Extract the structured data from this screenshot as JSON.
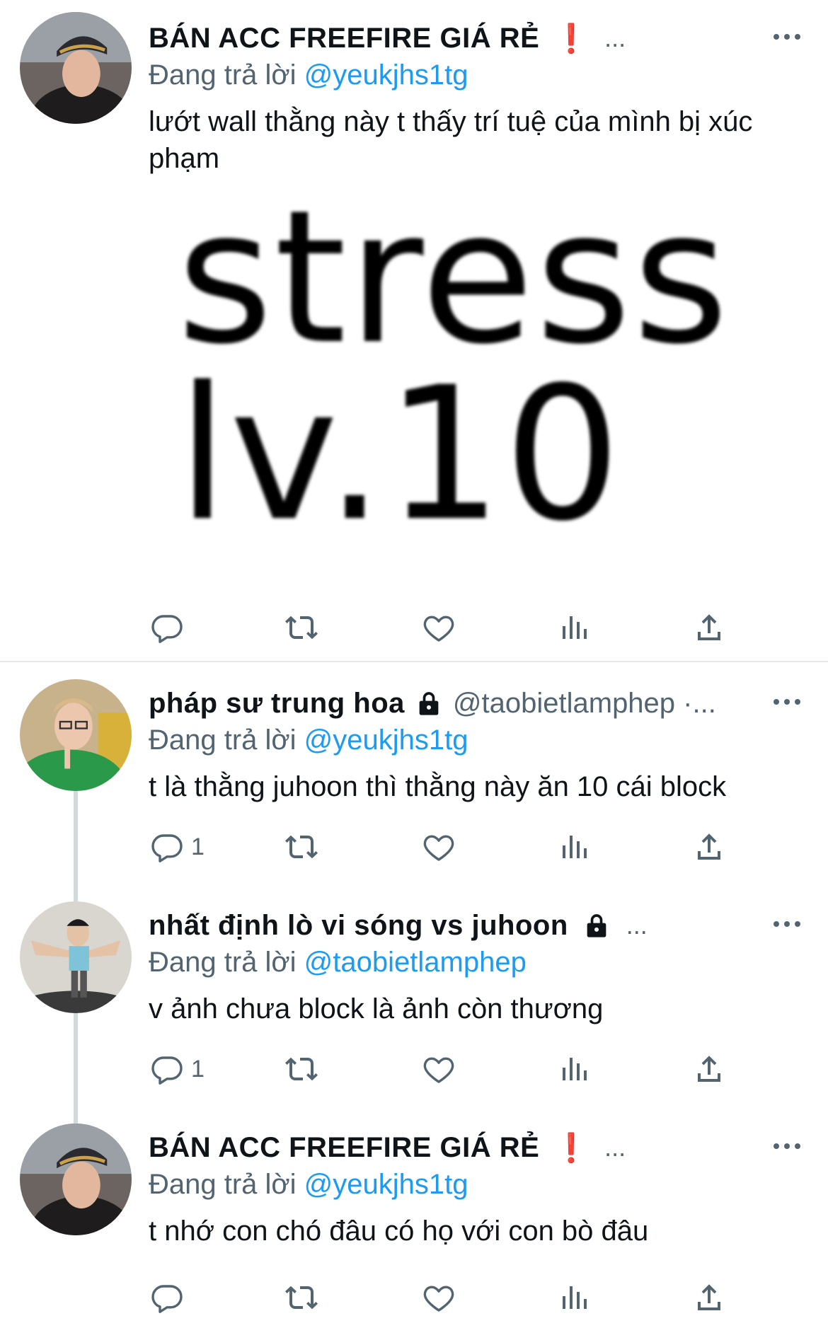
{
  "tweets": [
    {
      "display_name": "BÁN ACC FREEFIRE GIÁ RẺ",
      "badge": "❗",
      "trailing": "...",
      "reply_prefix": "Đang trả lời",
      "reply_mention": "@yeukjhs1tg",
      "text": "lướt wall thằng này t thấy trí tuệ của mình bị xúc phạm",
      "media_lines": [
        "stress",
        "lv.10"
      ],
      "reply_count": ""
    },
    {
      "display_name": "pháp sư trung hoa",
      "handle": "@taobietlamphep ·...",
      "reply_prefix": "Đang trả lời",
      "reply_mention": "@yeukjhs1tg",
      "text": "t là thằng juhoon thì thằng này ăn 10 cái block",
      "reply_count": "1"
    },
    {
      "display_name": "nhất định lò vi sóng vs juhoon",
      "trailing": "...",
      "reply_prefix": "Đang trả lời",
      "reply_mention": "@taobietlamphep",
      "text": "v ảnh chưa block là ảnh còn thương",
      "reply_count": "1"
    },
    {
      "display_name": "BÁN ACC FREEFIRE GIÁ RẺ",
      "badge": "❗",
      "trailing": "...",
      "reply_prefix": "Đang trả lời",
      "reply_mention": "@yeukjhs1tg",
      "text": "t nhớ con chó đâu có họ với con bò đâu",
      "reply_count": ""
    }
  ],
  "colors": {
    "link": "#1d9bf0",
    "secondary_text": "#536471",
    "badge_red": "#e0162b",
    "thread_line": "#cfd9de"
  },
  "icons": [
    "reply-icon",
    "retweet-icon",
    "like-icon",
    "views-icon",
    "share-icon",
    "more-icon",
    "lock-icon"
  ]
}
